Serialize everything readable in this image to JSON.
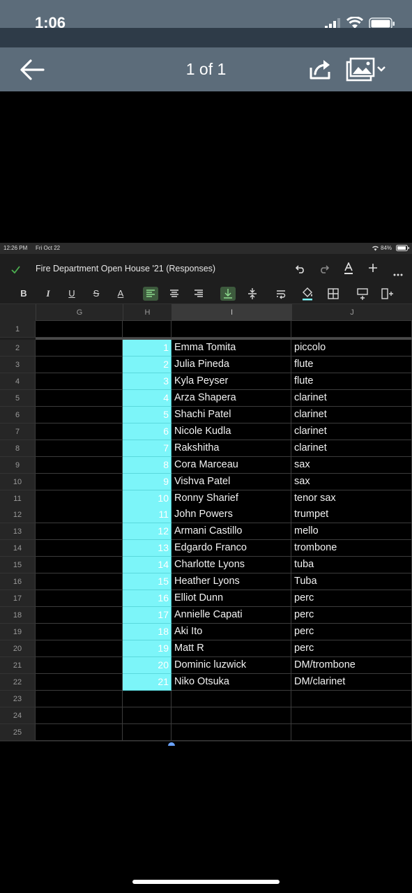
{
  "phone_status": {
    "time": "1:06"
  },
  "viewer": {
    "title": "1 of 1"
  },
  "ipad_status": {
    "time": "12:26 PM",
    "date": "Fri Oct 22",
    "battery": "84%"
  },
  "doc": {
    "title": "Fire Department Open House '21 (Responses)"
  },
  "format_toolbar": {
    "bold": "B",
    "italic": "I",
    "underline": "U",
    "strike": "S",
    "text_color": "A"
  },
  "columns": [
    "G",
    "H",
    "I",
    "J"
  ],
  "rows": [
    {
      "n": "1",
      "h": "",
      "name": "",
      "instrument": ""
    },
    {
      "n": "2",
      "h": "1",
      "name": "Emma Tomita",
      "instrument": "piccolo"
    },
    {
      "n": "3",
      "h": "2",
      "name": "Julia Pineda",
      "instrument": "flute"
    },
    {
      "n": "4",
      "h": "3",
      "name": "Kyla Peyser",
      "instrument": "flute"
    },
    {
      "n": "5",
      "h": "4",
      "name": "Arza Shapera",
      "instrument": "clarinet"
    },
    {
      "n": "6",
      "h": "5",
      "name": "Shachi Patel",
      "instrument": "clarinet"
    },
    {
      "n": "7",
      "h": "6",
      "name": "Nicole Kudla",
      "instrument": "clarinet"
    },
    {
      "n": "8",
      "h": "7",
      "name": "Rakshitha",
      "instrument": "clarinet"
    },
    {
      "n": "9",
      "h": "8",
      "name": "Cora Marceau",
      "instrument": "sax"
    },
    {
      "n": "10",
      "h": "9",
      "name": "Vishva Patel",
      "instrument": "sax"
    },
    {
      "n": "11",
      "h": "10",
      "name": "Ronny Sharief",
      "instrument": "tenor sax"
    },
    {
      "n": "12",
      "h": "11",
      "name": "John Powers",
      "instrument": "trumpet"
    },
    {
      "n": "13",
      "h": "12",
      "name": "Armani Castillo",
      "instrument": "mello"
    },
    {
      "n": "14",
      "h": "13",
      "name": "Edgardo Franco",
      "instrument": "trombone"
    },
    {
      "n": "15",
      "h": "14",
      "name": "Charlotte Lyons",
      "instrument": "tuba"
    },
    {
      "n": "16",
      "h": "15",
      "name": "Heather Lyons",
      "instrument": "Tuba"
    },
    {
      "n": "17",
      "h": "16",
      "name": "Elliot Dunn",
      "instrument": "perc"
    },
    {
      "n": "18",
      "h": "17",
      "name": "Annielle Capati",
      "instrument": "perc"
    },
    {
      "n": "19",
      "h": "18",
      "name": "Aki Ito",
      "instrument": "perc"
    },
    {
      "n": "20",
      "h": "19",
      "name": "Matt R",
      "instrument": "perc"
    },
    {
      "n": "21",
      "h": "20",
      "name": "Dominic luzwick",
      "instrument": "DM/trombone"
    },
    {
      "n": "22",
      "h": "21",
      "name": "Niko Otsuka",
      "instrument": "DM/clarinet"
    },
    {
      "n": "23",
      "h": "",
      "name": "",
      "instrument": ""
    },
    {
      "n": "24",
      "h": "",
      "name": "",
      "instrument": ""
    },
    {
      "n": "25",
      "h": "",
      "name": "",
      "instrument": ""
    }
  ],
  "colors": {
    "highlight": "#7cf5f9",
    "header_bar": "#5c6c7a",
    "check": "#4caf50"
  }
}
